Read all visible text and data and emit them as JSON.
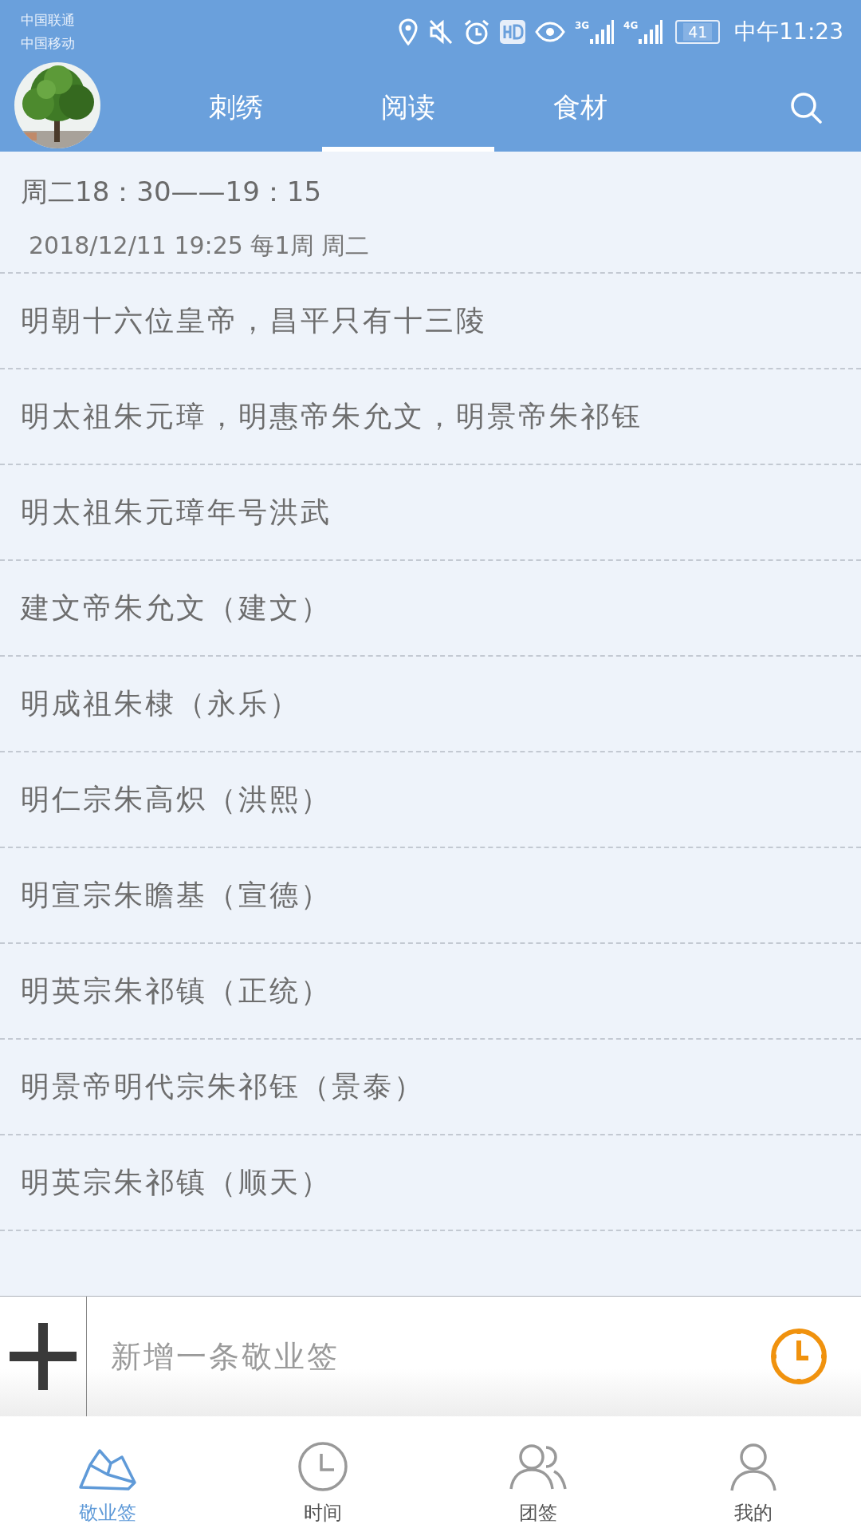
{
  "status_bar": {
    "carriers": [
      "中国联通",
      "中国移动"
    ],
    "network_labels": [
      "3G",
      "4G"
    ],
    "battery": "41",
    "time": "中午11:23"
  },
  "header": {
    "tabs": [
      {
        "label": "刺绣",
        "selected": false
      },
      {
        "label": "阅读",
        "selected": true
      },
      {
        "label": "食材",
        "selected": false
      }
    ]
  },
  "schedule": {
    "time_range": "周二18：30——19：15",
    "detail": "2018/12/11  19:25 每1周 周二"
  },
  "items": [
    "明朝十六位皇帝，昌平只有十三陵",
    "明太祖朱元璋，明惠帝朱允文，明景帝朱祁钰",
    "明太祖朱元璋年号洪武",
    "建文帝朱允文（建文）",
    "明成祖朱棣（永乐）",
    "明仁宗朱高炽（洪熙）",
    "明宣宗朱瞻基（宣德）",
    "明英宗朱祁镇（正统）",
    "明景帝明代宗朱祁钰（景泰）",
    "明英宗朱祁镇（顺天）"
  ],
  "composer": {
    "placeholder": "新增一条敬业签"
  },
  "bottom_nav": [
    {
      "label": "敬业签",
      "selected": true,
      "kind": "note"
    },
    {
      "label": "时间",
      "selected": false,
      "kind": "clock"
    },
    {
      "label": "团签",
      "selected": false,
      "kind": "group"
    },
    {
      "label": "我的",
      "selected": false,
      "kind": "person"
    }
  ]
}
